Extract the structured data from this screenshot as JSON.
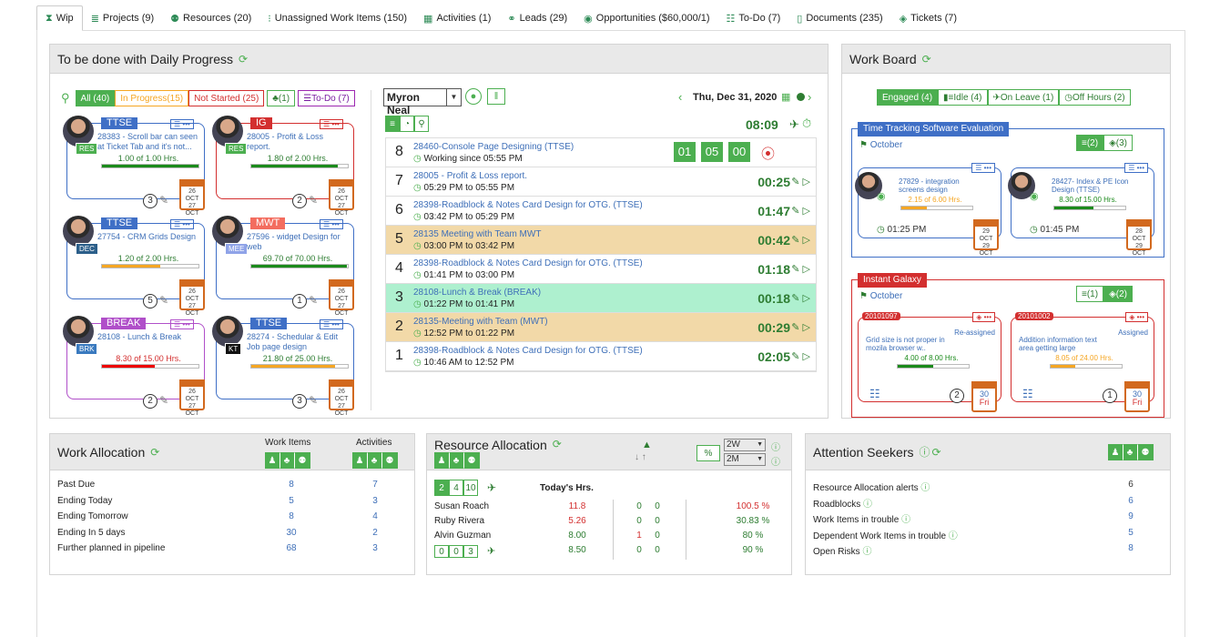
{
  "tabs": [
    {
      "label": "Wip",
      "icon": "hourglass-icon"
    },
    {
      "label": "Projects (9)",
      "icon": "list-icon"
    },
    {
      "label": "Resources (20)",
      "icon": "people-icon"
    },
    {
      "label": "Unassigned Work Items (150)",
      "icon": "unassigned-icon"
    },
    {
      "label": "Activities (1)",
      "icon": "calendar-check-icon"
    },
    {
      "label": "Leads (29)",
      "icon": "handshake-icon"
    },
    {
      "label": "Opportunities ($60,000/1)",
      "icon": "dollar-icon"
    },
    {
      "label": "To-Do (7)",
      "icon": "checklist-icon"
    },
    {
      "label": "Documents (235)",
      "icon": "document-icon"
    },
    {
      "label": "Tickets (7)",
      "icon": "ticket-icon"
    }
  ],
  "progress": {
    "title": "To be done with Daily Progress",
    "filters": {
      "all": "All (40)",
      "in_progress": "In Progress(15)",
      "not_started": "Not Started (25)",
      "team": "(1)",
      "todo": "To-Do (7)"
    },
    "cards": [
      {
        "tag": "TTSE",
        "tag_color": "#3f6fc6",
        "code": "RES",
        "code_color": "#4caf50",
        "text": "28383 - Scroll bar can seen at Ticket Tab and it's not...",
        "hours": "1.00 of 1.00 Hrs.",
        "hours_color": "#2e7d32",
        "bar_color": "#1b8a1b",
        "fill": 1.0,
        "count": "3",
        "date1": "26 OCT",
        "date2": "27 OCT",
        "border": "#3f6fc6"
      },
      {
        "tag": "IG",
        "tag_color": "#d32f2f",
        "code": "RES",
        "code_color": "#4caf50",
        "text": "28005 - Profit & Loss report.",
        "hours": "1.80 of 2.00 Hrs.",
        "hours_color": "#2e7d32",
        "bar_color": "#1b8a1b",
        "fill": 0.9,
        "count": "2",
        "date1": "26 OCT",
        "date2": "27 OCT",
        "border": "#d32f2f"
      },
      {
        "tag": "TTSE",
        "tag_color": "#3f6fc6",
        "code": "DEC",
        "code_color": "#2c5f8a",
        "text": "27754 - CRM Grids Design",
        "hours": "1.20 of 2.00 Hrs.",
        "hours_color": "#2e7d32",
        "bar_color": "#f5a623",
        "fill": 0.6,
        "count": "5",
        "date1": "26 OCT",
        "date2": "27 OCT",
        "border": "#3f6fc6"
      },
      {
        "tag": "MWT",
        "tag_color": "#f36d5f",
        "code": "MEE",
        "code_color": "#8fa3e8",
        "text": "27596 - widget Design for web",
        "hours": "69.70 of 70.00 Hrs.",
        "hours_color": "#2e7d32",
        "bar_color": "#1b8a1b",
        "fill": 0.99,
        "count": "1",
        "date1": "26 OCT",
        "date2": "27 OCT",
        "border": "#3f6fc6"
      },
      {
        "tag": "BREAK",
        "tag_color": "#b04fc9",
        "code": "BRK",
        "code_color": "#3a7abf",
        "text": "28108 - Lunch & Break",
        "hours": "8.30 of 15.00 Hrs.",
        "hours_color": "#d32f2f",
        "bar_color": "#e00",
        "fill": 0.55,
        "count": "2",
        "date1": "26 OCT",
        "date2": "27 OCT",
        "border": "#b04fc9"
      },
      {
        "tag": "TTSE",
        "tag_color": "#3f6fc6",
        "code": "KT",
        "code_color": "#111",
        "text": "28274 - Schedular & Edit Job page design",
        "hours": "21.80 of 25.00 Hrs.",
        "hours_color": "#2e7d32",
        "bar_color": "#f5a623",
        "fill": 0.87,
        "count": "3",
        "date1": "26 OCT",
        "date2": "27 OCT",
        "border": "#3f6fc6"
      }
    ],
    "person": "Myron Neal",
    "date": "Thu, Dec 31, 2020",
    "clock": "08:09",
    "timer": [
      "01",
      "05",
      "00"
    ],
    "rows": [
      {
        "n": "8",
        "t": "28460-Console Page Designing (TTSE)",
        "s": "Working since 05:55 PM",
        "time": "",
        "bg": "#fff"
      },
      {
        "n": "7",
        "t": "28005 - Profit & Loss report.",
        "s": "05:29 PM to 05:55 PM",
        "time": "00:25",
        "bg": "#fff"
      },
      {
        "n": "6",
        "t": "28398-Roadblock & Notes Card Design for OTG. (TTSE)",
        "s": "03:42 PM to 05:29 PM",
        "time": "01:47",
        "bg": "#fff"
      },
      {
        "n": "5",
        "t": "28135 Meeting with Team MWT",
        "s": "03:00 PM to 03:42 PM",
        "time": "00:42",
        "bg": "#f2d9a8"
      },
      {
        "n": "4",
        "t": "28398-Roadblock & Notes Card Design for OTG. (TTSE)",
        "s": "01:41 PM to 03:00 PM",
        "time": "01:18",
        "bg": "#fff"
      },
      {
        "n": "3",
        "t": "28108-Lunch & Break (BREAK)",
        "s": "01:22 PM to 01:41 PM",
        "time": "00:18",
        "bg": "#aef0cf"
      },
      {
        "n": "2",
        "t": "28135-Meeting with Team (MWT)",
        "s": "12:52 PM to 01:22 PM",
        "time": "00:29",
        "bg": "#f2d9a8"
      },
      {
        "n": "1",
        "t": "28398-Roadblock & Notes Card Design for OTG. (TTSE)",
        "s": "10:46 AM to 12:52 PM",
        "time": "02:05",
        "bg": "#fff"
      }
    ]
  },
  "board": {
    "title": "Work Board",
    "filters": [
      "Engaged (4)",
      "Idle (4)",
      "On Leave (1)",
      "Off Hours (2)"
    ],
    "groups": [
      {
        "name": "Time Tracking Software Evaluation",
        "color": "#3f6fc6",
        "month": "October",
        "c1": "(2)",
        "c2": "(3)",
        "items": [
          {
            "text": "27829 - integration screens design",
            "hours": "2.15 of 6.00 Hrs.",
            "hc": "#f5a623",
            "fill": 0.36,
            "time": "01:25 PM",
            "d1": "29 OCT",
            "d2": "29 OCT"
          },
          {
            "text": "28427- Index & PE Icon Design (TTSE)",
            "hours": "8.30 of 15.00 Hrs.",
            "hc": "#1b8a1b",
            "fill": 0.55,
            "time": "01:45 PM",
            "d1": "28 OCT",
            "d2": "29 OCT"
          }
        ]
      },
      {
        "name": "Instant Galaxy",
        "color": "#d32f2f",
        "month": "October",
        "c1": "(1)",
        "c2": "(2)",
        "items": [
          {
            "id": "20101097",
            "status": "Re-assigned",
            "text": "Grid size is not proper in mozila browser w..",
            "hours": "4.00 of 8.00 Hrs.",
            "hc": "#1b8a1b",
            "fill": 0.5,
            "count": "2",
            "day": "30",
            "dow": "Fri"
          },
          {
            "id": "20101002",
            "status": "Assigned",
            "text": "Addition information text area getting large",
            "hours": "8.05 of 24.00 Hrs.",
            "hc": "#f5a623",
            "fill": 0.34,
            "count": "1",
            "day": "30",
            "dow": "Fri"
          }
        ]
      }
    ]
  },
  "work_alloc": {
    "title": "Work Allocation",
    "col1": "Work Items",
    "col2": "Activities",
    "rows": [
      {
        "l": "Past Due",
        "a": "8",
        "b": "7"
      },
      {
        "l": "Ending Today",
        "a": "5",
        "b": "3"
      },
      {
        "l": "Ending Tomorrow",
        "a": "8",
        "b": "4"
      },
      {
        "l": "Ending In 5 days",
        "a": "30",
        "b": "2"
      },
      {
        "l": "Further planned in pipeline",
        "a": "68",
        "b": "3"
      }
    ]
  },
  "res_alloc": {
    "title": "Resource Allocation",
    "sel1": "2W",
    "sel2": "2M",
    "tabs": [
      "2",
      "4",
      "10"
    ],
    "today": "Today's Hrs.",
    "rows": [
      {
        "n": "Susan Roach",
        "h": "11.8",
        "hc": "#d32f2f",
        "a": "0",
        "b": "0",
        "bc": "#2e7d32",
        "p": "100.5 %",
        "pc": "#d32f2f"
      },
      {
        "n": "Ruby Rivera",
        "h": "5.26",
        "hc": "#d32f2f",
        "a": "0",
        "b": "0",
        "bc": "#2e7d32",
        "p": "30.83 %",
        "pc": "#2e7d32"
      },
      {
        "n": "Alvin Guzman",
        "h": "8.00",
        "hc": "#2e7d32",
        "a": "1",
        "b": "0",
        "bc": "#d32f2f",
        "p": "80 %",
        "pc": "#2e7d32"
      }
    ],
    "total": {
      "c": [
        "0",
        "0",
        "3"
      ],
      "h": "8.50",
      "a": "0",
      "b": "0",
      "p": "90 %"
    }
  },
  "attention": {
    "title": "Attention Seekers",
    "rows": [
      {
        "l": "Resource Allocation alerts",
        "v": "6",
        "c": "#333"
      },
      {
        "l": "Roadblocks",
        "v": "6",
        "c": "#3e6fb8"
      },
      {
        "l": "Work Items in trouble",
        "v": "9",
        "c": "#3e6fb8"
      },
      {
        "l": "Dependent Work Items in trouble",
        "v": "5",
        "c": "#3e6fb8"
      },
      {
        "l": "Open Risks",
        "v": "8",
        "c": "#3e6fb8"
      }
    ]
  }
}
